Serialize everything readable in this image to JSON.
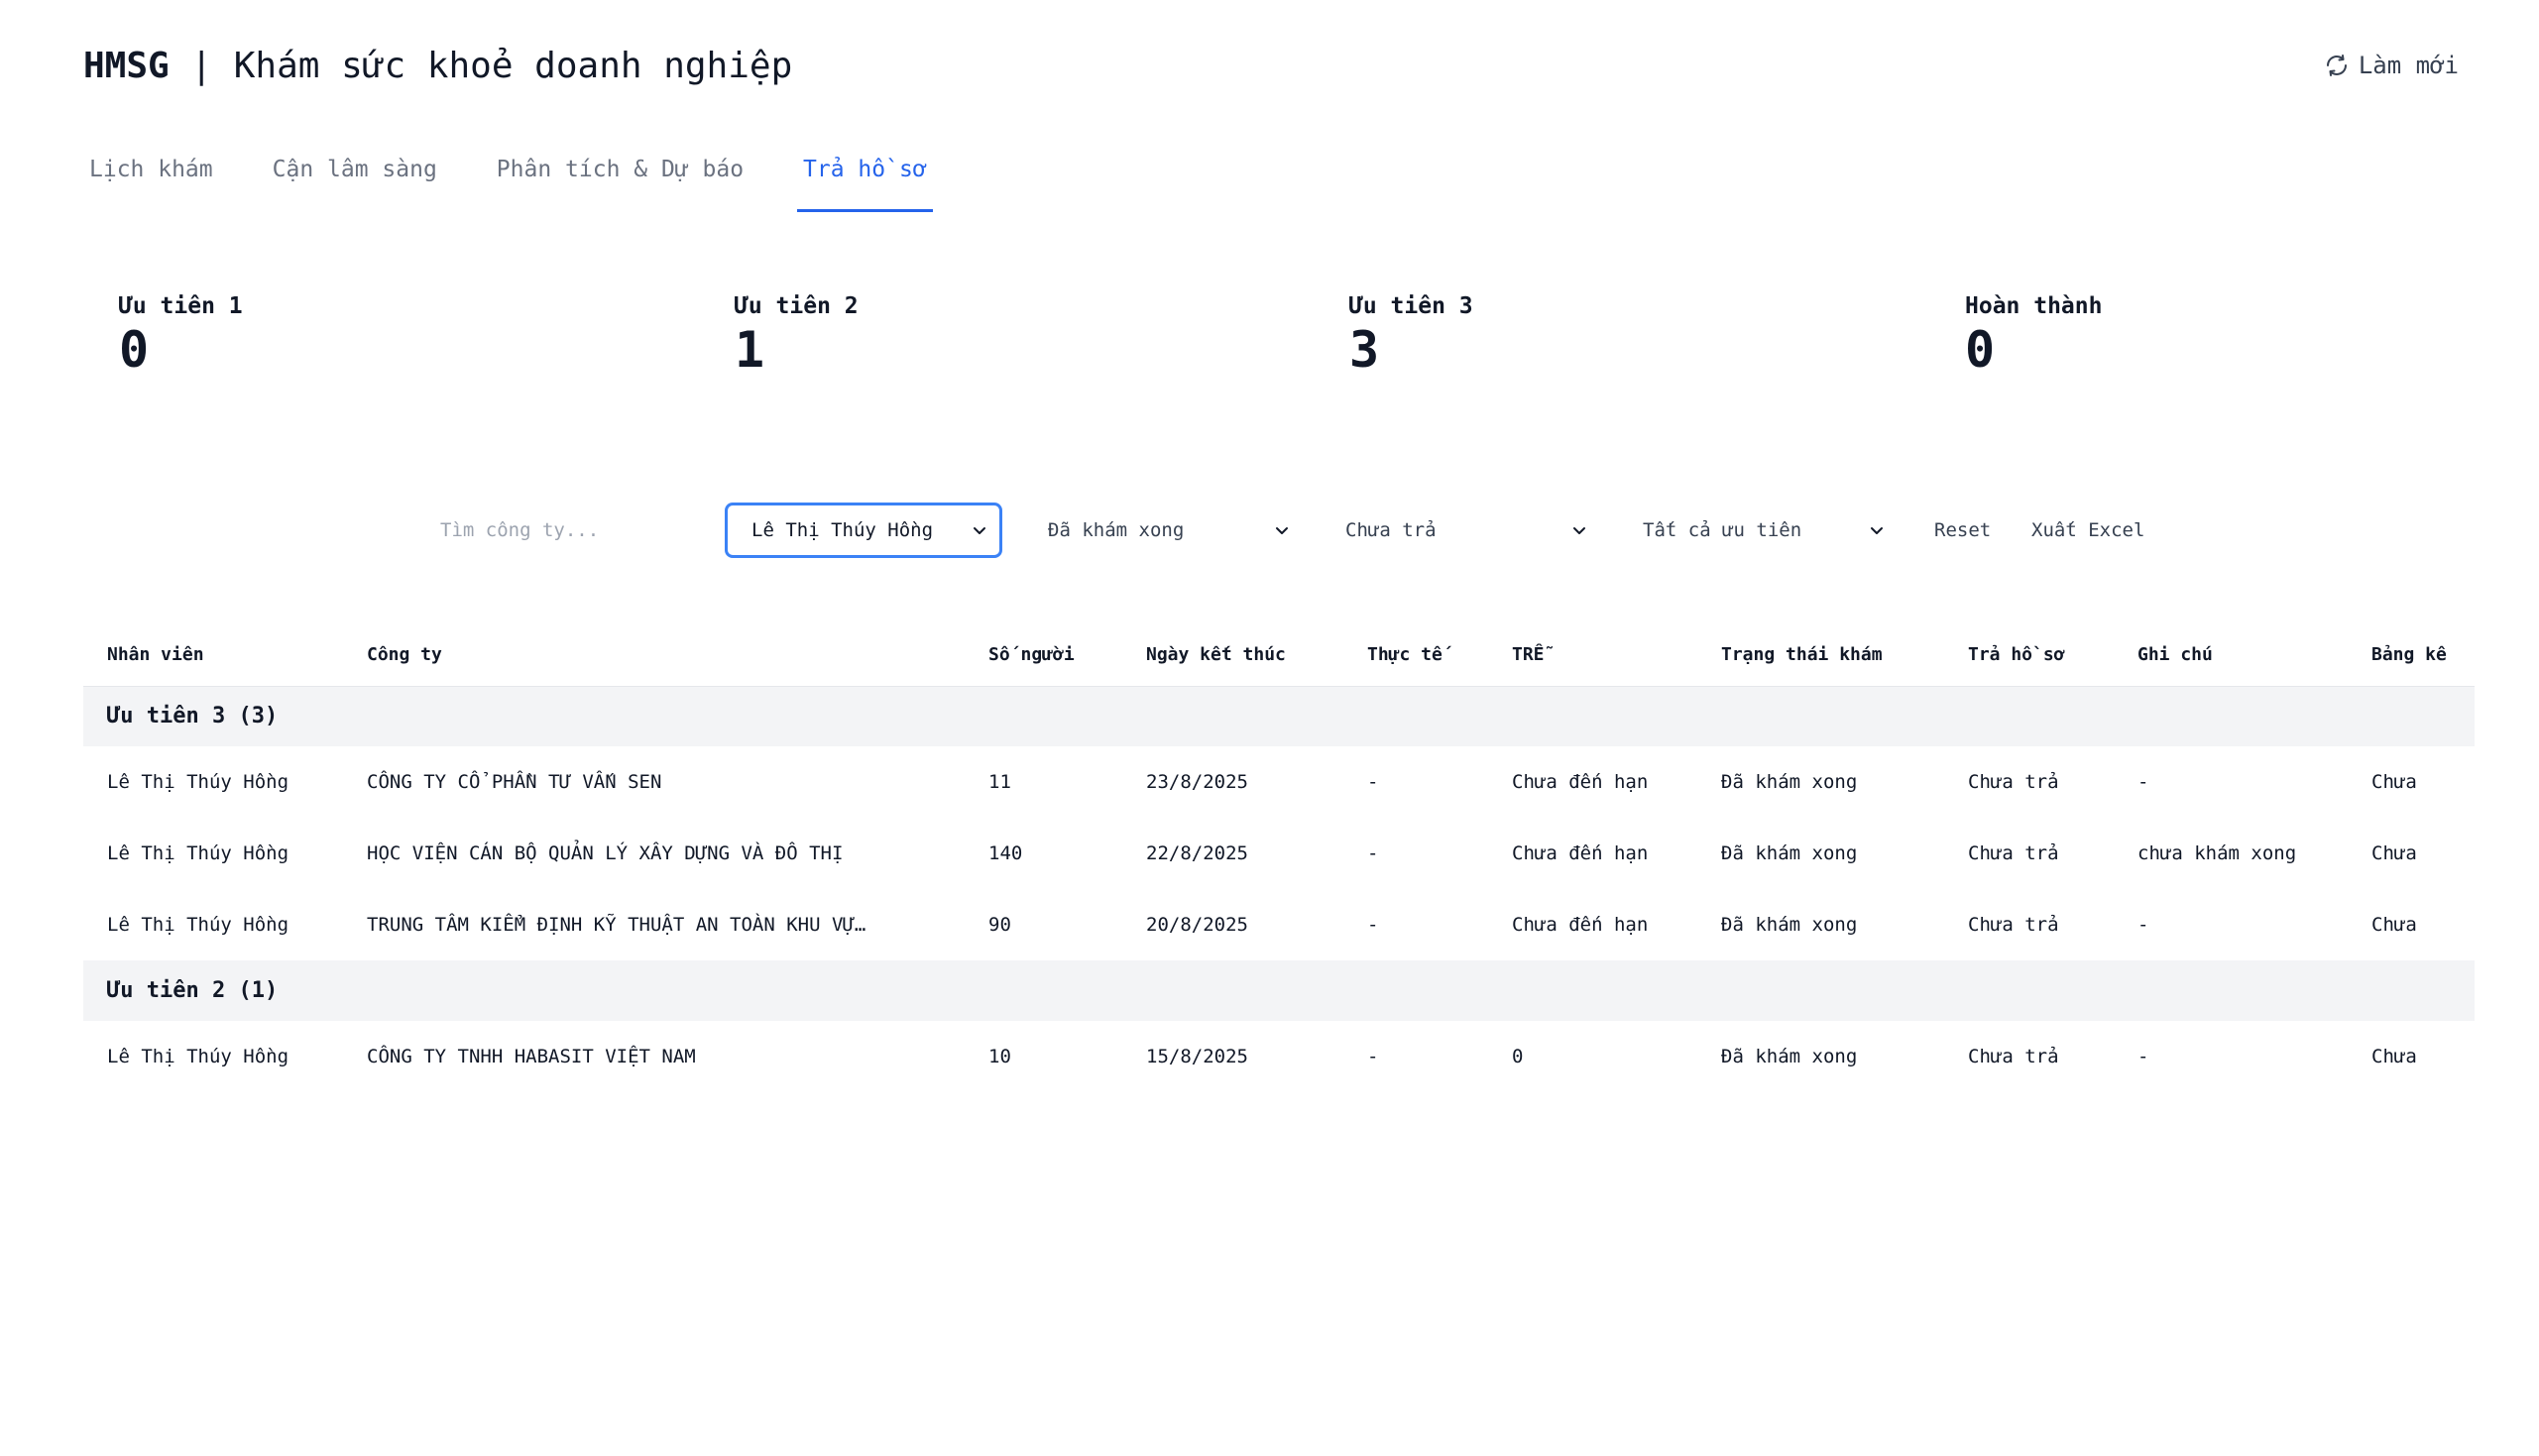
{
  "header": {
    "brand": "HMSG",
    "separator": " | ",
    "title": "Khám sức khoẻ doanh nghiệp",
    "refresh_label": "Làm mới"
  },
  "tabs": [
    {
      "label": "Lịch khám",
      "active": false
    },
    {
      "label": "Cận lâm sàng",
      "active": false
    },
    {
      "label": "Phân tích & Dự báo",
      "active": false
    },
    {
      "label": "Trả hồ sơ",
      "active": true
    }
  ],
  "stats": [
    {
      "label": "Ưu tiên 1",
      "value": "0"
    },
    {
      "label": "Ưu tiên 2",
      "value": "1"
    },
    {
      "label": "Ưu tiên 3",
      "value": "3"
    },
    {
      "label": "Hoàn thành",
      "value": "0"
    }
  ],
  "filters": {
    "search_placeholder": "Tìm công ty...",
    "staff_selected": "Lê Thị Thúy Hồng",
    "exam_status_selected": "Đã khám xong",
    "return_status_selected": "Chưa trả",
    "priority_selected": "Tất cả ưu tiên",
    "reset_label": "Reset",
    "export_label": "Xuất Excel"
  },
  "table": {
    "columns": [
      "Nhân viên",
      "Công ty",
      "Số người",
      "Ngày kết thúc",
      "Thực tế",
      "TRỄ",
      "Trạng thái khám",
      "Trả hồ sơ",
      "Ghi chú",
      "Bảng kê"
    ],
    "groups": [
      {
        "label": "Ưu tiên 3 (3)",
        "rows": [
          {
            "staff": "Lê Thị Thúy Hồng",
            "company": "CÔNG TY CỔ PHẦN TƯ VẤN SEN",
            "people": "11",
            "end_date": "23/8/2025",
            "actual": "-",
            "late": "Chưa đến hạn",
            "exam_status": "Đã khám xong",
            "return_status": "Chưa trả",
            "note": "-",
            "list": "Chưa"
          },
          {
            "staff": "Lê Thị Thúy Hồng",
            "company": "HỌC VIỆN CÁN BỘ QUẢN LÝ XÂY DỰNG VÀ ĐÔ THỊ",
            "people": "140",
            "end_date": "22/8/2025",
            "actual": "-",
            "late": "Chưa đến hạn",
            "exam_status": "Đã khám xong",
            "return_status": "Chưa trả",
            "note": "chưa khám xong",
            "list": "Chưa"
          },
          {
            "staff": "Lê Thị Thúy Hồng",
            "company": "TRUNG TÂM KIỂM ĐỊNH KỸ THUẬT AN TOÀN KHU VỰ…",
            "people": "90",
            "end_date": "20/8/2025",
            "actual": "-",
            "late": "Chưa đến hạn",
            "exam_status": "Đã khám xong",
            "return_status": "Chưa trả",
            "note": "-",
            "list": "Chưa"
          }
        ]
      },
      {
        "label": "Ưu tiên 2 (1)",
        "rows": [
          {
            "staff": "Lê Thị Thúy Hồng",
            "company": "CÔNG TY TNHH HABASIT VIỆT NAM",
            "people": "10",
            "end_date": "15/8/2025",
            "actual": "-",
            "late": "0",
            "exam_status": "Đã khám xong",
            "return_status": "Chưa trả",
            "note": "-",
            "list": "Chưa"
          }
        ]
      }
    ]
  },
  "colors": {
    "accent": "#2563eb",
    "status_done": "#3b6fd8",
    "status_unreturned": "#e53e3e",
    "group_bg": "#f3f4f6"
  }
}
